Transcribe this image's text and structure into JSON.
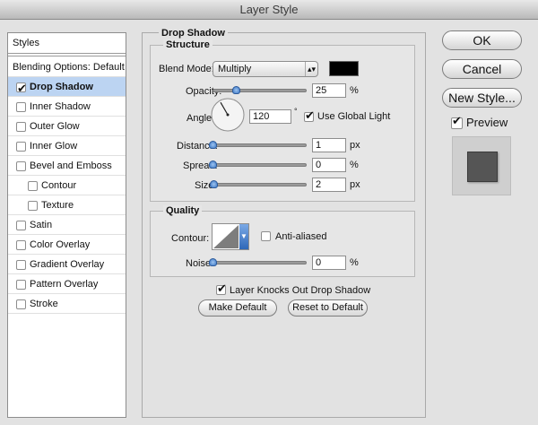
{
  "window": {
    "title": "Layer Style"
  },
  "styles_panel": {
    "header": "Styles",
    "items": [
      {
        "label": "Blending Options: Default",
        "checkbox": false,
        "checked": false,
        "indent": false,
        "selected": false
      },
      {
        "label": "Drop Shadow",
        "checkbox": true,
        "checked": true,
        "indent": false,
        "selected": true
      },
      {
        "label": "Inner Shadow",
        "checkbox": true,
        "checked": false,
        "indent": false,
        "selected": false
      },
      {
        "label": "Outer Glow",
        "checkbox": true,
        "checked": false,
        "indent": false,
        "selected": false
      },
      {
        "label": "Inner Glow",
        "checkbox": true,
        "checked": false,
        "indent": false,
        "selected": false
      },
      {
        "label": "Bevel and Emboss",
        "checkbox": true,
        "checked": false,
        "indent": false,
        "selected": false
      },
      {
        "label": "Contour",
        "checkbox": true,
        "checked": false,
        "indent": true,
        "selected": false
      },
      {
        "label": "Texture",
        "checkbox": true,
        "checked": false,
        "indent": true,
        "selected": false
      },
      {
        "label": "Satin",
        "checkbox": true,
        "checked": false,
        "indent": false,
        "selected": false
      },
      {
        "label": "Color Overlay",
        "checkbox": true,
        "checked": false,
        "indent": false,
        "selected": false
      },
      {
        "label": "Gradient Overlay",
        "checkbox": true,
        "checked": false,
        "indent": false,
        "selected": false
      },
      {
        "label": "Pattern Overlay",
        "checkbox": true,
        "checked": false,
        "indent": false,
        "selected": false
      },
      {
        "label": "Stroke",
        "checkbox": true,
        "checked": false,
        "indent": false,
        "selected": false
      }
    ]
  },
  "drop_shadow": {
    "section_title": "Drop Shadow",
    "structure": {
      "title": "Structure",
      "blend_mode_label": "Blend Mode:",
      "blend_mode_value": "Multiply",
      "shadow_color": "#000000",
      "opacity_label": "Opacity:",
      "opacity_value": "25",
      "opacity_unit": "%",
      "opacity_fraction": 0.25,
      "angle_label": "Angle:",
      "angle_value": "120",
      "angle_unit": "°",
      "angle_degrees": 120,
      "use_global_light_label": "Use Global Light",
      "use_global_light_checked": true,
      "distance_label": "Distance:",
      "distance_value": "1",
      "distance_unit": "px",
      "distance_fraction": 0.0,
      "spread_label": "Spread:",
      "spread_value": "0",
      "spread_unit": "%",
      "spread_fraction": 0.0,
      "size_label": "Size:",
      "size_value": "2",
      "size_unit": "px",
      "size_fraction": 0.01
    },
    "quality": {
      "title": "Quality",
      "contour_label": "Contour:",
      "anti_aliased_label": "Anti-aliased",
      "anti_aliased_checked": false,
      "noise_label": "Noise:",
      "noise_value": "0",
      "noise_unit": "%",
      "noise_fraction": 0.0
    },
    "layer_knocks_out_label": "Layer Knocks Out Drop Shadow",
    "layer_knocks_out_checked": true,
    "make_default_label": "Make Default",
    "reset_to_default_label": "Reset to Default"
  },
  "actions": {
    "ok_label": "OK",
    "cancel_label": "Cancel",
    "new_style_label": "New Style...",
    "preview_label": "Preview",
    "preview_checked": true
  }
}
